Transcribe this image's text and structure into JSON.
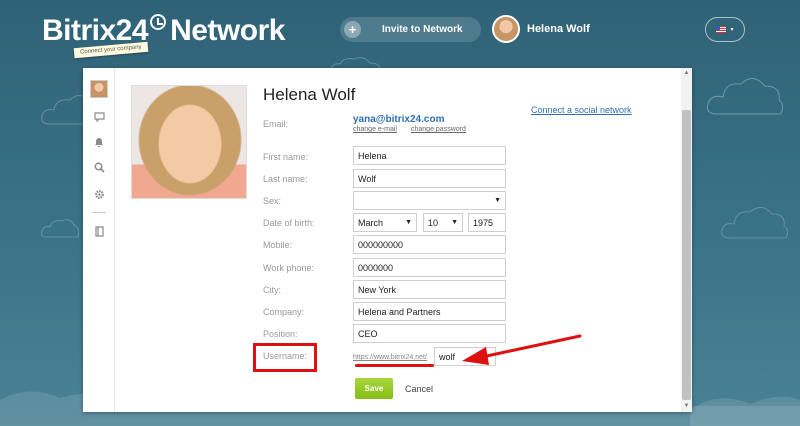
{
  "header": {
    "logo_text": "Bitrix24",
    "logo_suffix": "Network",
    "tagline": "Connect your company",
    "invite_label": "Invite to Network",
    "user_name": "Helena Wolf",
    "lang_caret": "▾"
  },
  "profile": {
    "name": "Helena Wolf",
    "connect_social": "Connect a social network",
    "email_label": "Email:",
    "email_value": "yana@bitrix24.com",
    "change_email": "change e-mail",
    "change_password": "change password",
    "fields": {
      "first_name": {
        "label": "First name:",
        "value": "Helena"
      },
      "last_name": {
        "label": "Last name:",
        "value": "Wolf"
      },
      "sex": {
        "label": "Sex:",
        "value": ""
      },
      "dob": {
        "label": "Date of birth:",
        "month": "March",
        "day": "10",
        "year": "1975"
      },
      "mobile": {
        "label": "Mobile:",
        "value": "000000000"
      },
      "work_phone": {
        "label": "Work phone:",
        "value": "0000000"
      },
      "city": {
        "label": "City:",
        "value": "New York"
      },
      "company": {
        "label": "Company:",
        "value": "Helena and Partners"
      },
      "position": {
        "label": "Position:",
        "value": "CEO"
      },
      "username": {
        "label": "Username:",
        "prefix": "https://www.bitrix24.net/",
        "value": "wolf"
      }
    },
    "save_label": "Save",
    "cancel_label": "Cancel"
  },
  "colors": {
    "accent": "#2f6fb4",
    "save": "#8cc21a",
    "annotation": "#dd1111",
    "background": "#3a7388"
  }
}
